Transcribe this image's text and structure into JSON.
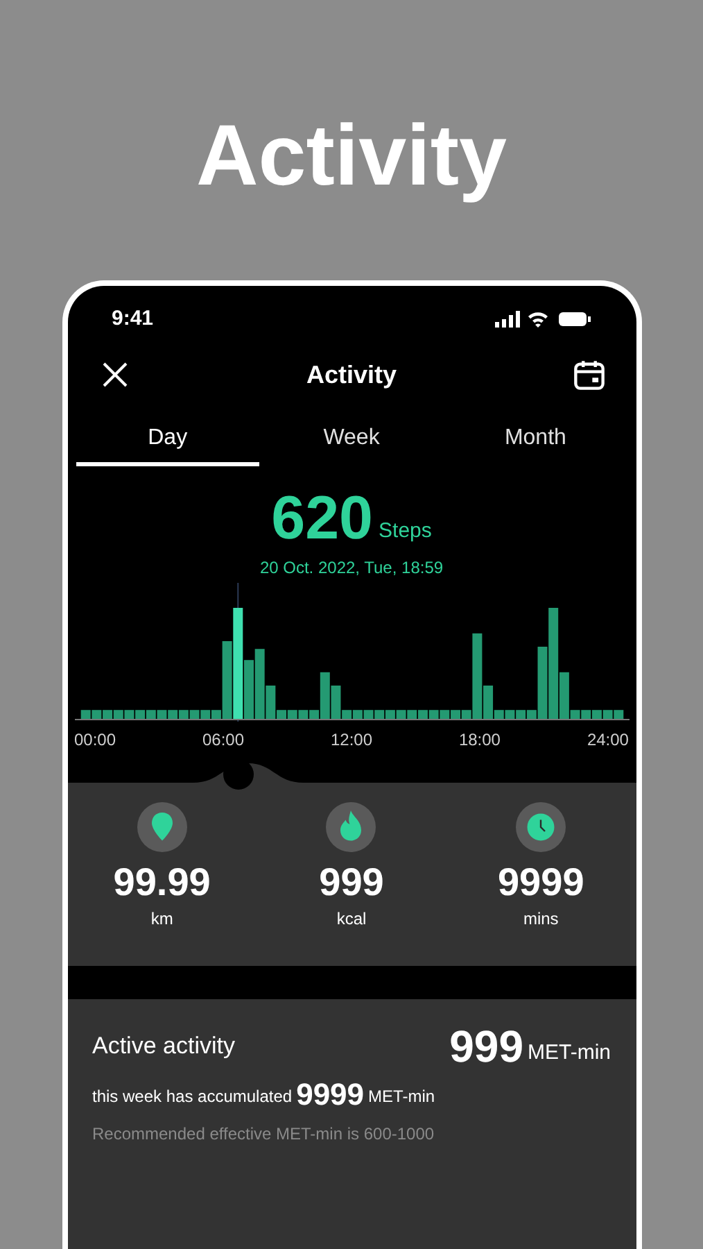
{
  "headline": "Activity",
  "status_bar": {
    "time": "9:41"
  },
  "header": {
    "title": "Activity"
  },
  "tabs": [
    {
      "label": "Day",
      "selected": true
    },
    {
      "label": "Week",
      "selected": false
    },
    {
      "label": "Month",
      "selected": false
    }
  ],
  "summary": {
    "value": "620",
    "unit": "Steps",
    "timestamp": "20 Oct. 2022, Tue, 18:59"
  },
  "chart": {
    "x_labels": [
      "00:00",
      "06:00",
      "12:00",
      "18:00",
      "24:00"
    ]
  },
  "stats": [
    {
      "kind": "distance",
      "value": "99.99",
      "unit": "km"
    },
    {
      "kind": "calories",
      "value": "999",
      "unit": "kcal"
    },
    {
      "kind": "duration",
      "value": "9999",
      "unit": "mins"
    }
  ],
  "active_activity": {
    "title": "Active activity",
    "value": "999",
    "unit": "MET-min",
    "week_prefix": "this week has accumulated",
    "week_value": "9999",
    "week_unit": "MET-min",
    "note": "Recommended effective MET-min is 600-1000"
  }
}
